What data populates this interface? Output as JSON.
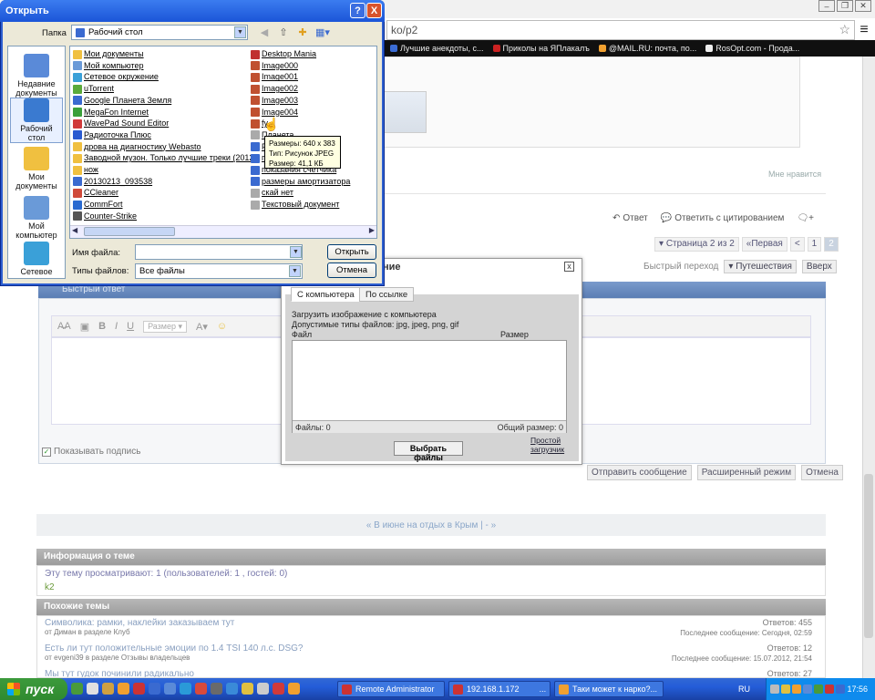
{
  "browser": {
    "url_fragment": "ko/p2",
    "bookmarks": [
      {
        "label": "Лучшие анекдоты, с...",
        "color": "#3b6cd4"
      },
      {
        "label": "Приколы на ЯПлакалъ",
        "color": "#cc2222"
      },
      {
        "label": "@MAIL.RU: почта, по...",
        "color": "#f0a030"
      },
      {
        "label": "RosOpt.com - Прода...",
        "color": "#eeeeee"
      }
    ]
  },
  "forum": {
    "likes": "Мне нравится",
    "reply_label": "Ответ",
    "quote_label": "Ответить с цитированием",
    "pager": {
      "info": "Страница 2 из 2",
      "first": "«Первая",
      "prev": "<",
      "p1": "1",
      "p2": "2"
    },
    "quick_nav_label": "Быстрый переход",
    "quick_nav_value": "Путешествия",
    "up_label": "Вверх",
    "quick_reply_title": "Быстрый ответ",
    "editor_size_label": "Размер",
    "show_signature": "Показывать подпись",
    "send_buttons": [
      "Отправить сообщение",
      "Расширенный режим",
      "Отмена"
    ],
    "prev_next": "« В июне на отдых в Крым | - »",
    "info_title": "Информация о теме",
    "info_text": "Эту тему просматривают: 1 (пользователей: 1 , гостей: 0)",
    "info_user": "k2",
    "similar_title": "Похожие темы",
    "similar": [
      {
        "title": "Символика: рамки, наклейки заказываем тут",
        "sub": "от Диман в разделе Клуб",
        "answers": "Ответов: 455",
        "last": "Последнее сообщение: Сегодня, 02:59"
      },
      {
        "title": "Есть ли тут положительные эмоции по 1.4 TSI 140 л.с. DSG?",
        "sub": "от evgeni39 в разделе Отзывы владельцев",
        "answers": "Ответов: 12",
        "last": "Последнее сообщение: 15.07.2012, 21:54"
      },
      {
        "title": "Мы тут гудок починили радикально",
        "sub": "",
        "answers": "Ответов: 27",
        "last": ""
      }
    ]
  },
  "upload": {
    "title_partial": "ние",
    "close": "x",
    "tab_computer": "С компьютера",
    "tab_link": "По ссылке",
    "line1": "Загрузить изображение с компьютера",
    "line2": "Допустимые типы файлов: jpg, jpeg, png, gif",
    "col_file": "Файл",
    "col_size": "Размер",
    "files_count": "Файлы: 0",
    "total_size": "Общий размер: 0",
    "pick_button": "Выбрать файлы",
    "simple_link": "Простой загрузчик"
  },
  "dialog": {
    "title": "Открыть",
    "help": "?",
    "close": "X",
    "folder_label": "Папка",
    "folder_value": "Рабочий стол",
    "places": [
      {
        "label": "Недавние документы",
        "color": "#5a8ad8"
      },
      {
        "label": "Рабочий стол",
        "color": "#3a7ad0"
      },
      {
        "label": "Мои документы",
        "color": "#f0c040"
      },
      {
        "label": "Мой компьютер",
        "color": "#6a9ad8"
      },
      {
        "label": "Сетевое",
        "color": "#3aa0d8"
      }
    ],
    "files_col1": [
      {
        "name": "Мои документы",
        "color": "#f0c040"
      },
      {
        "name": "Мой компьютер",
        "color": "#6a9ad8"
      },
      {
        "name": "Сетевое окружение",
        "color": "#3aa0d8"
      },
      {
        "name": "uTorrent",
        "color": "#5aaa3a"
      },
      {
        "name": "Google Планета Земля",
        "color": "#3a6ad0"
      },
      {
        "name": "MegaFon Internet",
        "color": "#3aa03a"
      },
      {
        "name": "WavePad Sound Editor",
        "color": "#d03a3a"
      },
      {
        "name": "Радиоточка Плюс",
        "color": "#2a5ad0"
      },
      {
        "name": "дрова на диагностику Webasto",
        "color": "#f0c040"
      },
      {
        "name": "Заводной музон. Только лучшие треки (2012)",
        "color": "#f0c040"
      },
      {
        "name": "нож",
        "color": "#f0c040"
      },
      {
        "name": "20130213_093538",
        "color": "#3a6ad0"
      },
      {
        "name": "CCleaner",
        "color": "#d04a3a"
      },
      {
        "name": "CommFort",
        "color": "#2a6ad0"
      },
      {
        "name": "Counter-Strike",
        "color": "#555555"
      }
    ],
    "files_col2": [
      {
        "name": "Desktop Mania",
        "color": "#c03030"
      },
      {
        "name": "Image000",
        "color": "#c05030"
      },
      {
        "name": "Image001",
        "color": "#c05030"
      },
      {
        "name": "Image002",
        "color": "#c05030"
      },
      {
        "name": "Image003",
        "color": "#c05030"
      },
      {
        "name": "Image004",
        "color": "#c05030"
      },
      {
        "name": "fy",
        "color": "#c05030"
      },
      {
        "name": "Планета",
        "color": "#aaaaaa"
      },
      {
        "name": "Рисунок...е",
        "color": "#3a6ad0"
      },
      {
        "name": "плено",
        "color": "#3a6ad0"
      },
      {
        "name": "показания счетчика",
        "color": "#3a6ad0"
      },
      {
        "name": "размеры амортизатора",
        "color": "#3a6ad0"
      },
      {
        "name": "скай нет",
        "color": "#aaaaaa"
      },
      {
        "name": "Текстовый документ",
        "color": "#aaaaaa"
      }
    ],
    "tooltip": [
      "Размеры: 640 x 383",
      "Тип: Рисунок JPEG",
      "Размер: 41,1 КБ"
    ],
    "filename_label": "Имя файла:",
    "filename_value": "",
    "filetype_label": "Типы файлов:",
    "filetype_value": "Все файлы",
    "open_button": "Открыть",
    "cancel_button": "Отмена"
  },
  "taskbar": {
    "start": "пуск",
    "tasks": [
      {
        "label": "Remote Administrator",
        "color": "#cc3333"
      },
      {
        "label": "192.168.1.172",
        "color": "#cc3333"
      },
      {
        "label": "...",
        "color": "#3d77e0"
      },
      {
        "label": "Таки может к нарко?...",
        "color": "#f0a030"
      }
    ],
    "lang": "RU",
    "clock": "17:56"
  }
}
